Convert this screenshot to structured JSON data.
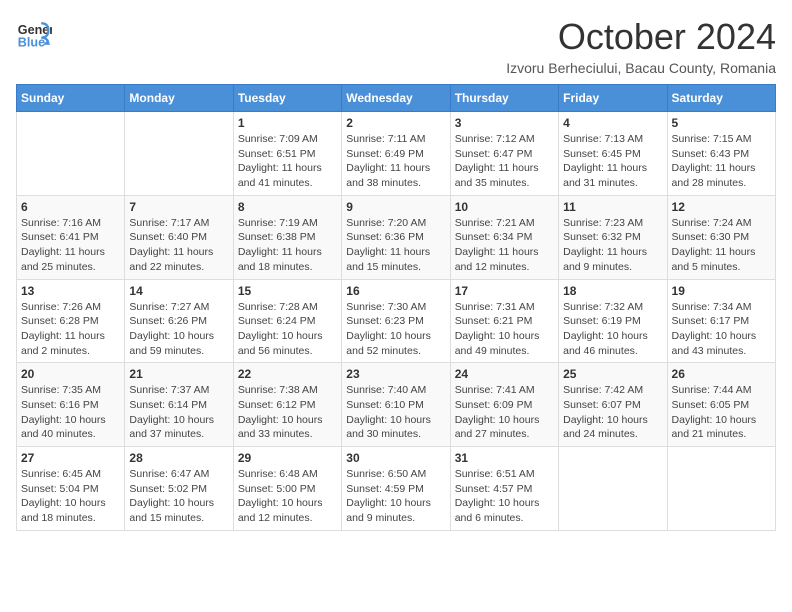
{
  "header": {
    "logo": {
      "general": "General",
      "blue": "Blue"
    },
    "title": "October 2024",
    "location": "Izvoru Berheciului, Bacau County, Romania"
  },
  "calendar": {
    "days_of_week": [
      "Sunday",
      "Monday",
      "Tuesday",
      "Wednesday",
      "Thursday",
      "Friday",
      "Saturday"
    ],
    "weeks": [
      [
        {
          "day": "",
          "info": ""
        },
        {
          "day": "",
          "info": ""
        },
        {
          "day": "1",
          "info": "Sunrise: 7:09 AM\nSunset: 6:51 PM\nDaylight: 11 hours and 41 minutes."
        },
        {
          "day": "2",
          "info": "Sunrise: 7:11 AM\nSunset: 6:49 PM\nDaylight: 11 hours and 38 minutes."
        },
        {
          "day": "3",
          "info": "Sunrise: 7:12 AM\nSunset: 6:47 PM\nDaylight: 11 hours and 35 minutes."
        },
        {
          "day": "4",
          "info": "Sunrise: 7:13 AM\nSunset: 6:45 PM\nDaylight: 11 hours and 31 minutes."
        },
        {
          "day": "5",
          "info": "Sunrise: 7:15 AM\nSunset: 6:43 PM\nDaylight: 11 hours and 28 minutes."
        }
      ],
      [
        {
          "day": "6",
          "info": "Sunrise: 7:16 AM\nSunset: 6:41 PM\nDaylight: 11 hours and 25 minutes."
        },
        {
          "day": "7",
          "info": "Sunrise: 7:17 AM\nSunset: 6:40 PM\nDaylight: 11 hours and 22 minutes."
        },
        {
          "day": "8",
          "info": "Sunrise: 7:19 AM\nSunset: 6:38 PM\nDaylight: 11 hours and 18 minutes."
        },
        {
          "day": "9",
          "info": "Sunrise: 7:20 AM\nSunset: 6:36 PM\nDaylight: 11 hours and 15 minutes."
        },
        {
          "day": "10",
          "info": "Sunrise: 7:21 AM\nSunset: 6:34 PM\nDaylight: 11 hours and 12 minutes."
        },
        {
          "day": "11",
          "info": "Sunrise: 7:23 AM\nSunset: 6:32 PM\nDaylight: 11 hours and 9 minutes."
        },
        {
          "day": "12",
          "info": "Sunrise: 7:24 AM\nSunset: 6:30 PM\nDaylight: 11 hours and 5 minutes."
        }
      ],
      [
        {
          "day": "13",
          "info": "Sunrise: 7:26 AM\nSunset: 6:28 PM\nDaylight: 11 hours and 2 minutes."
        },
        {
          "day": "14",
          "info": "Sunrise: 7:27 AM\nSunset: 6:26 PM\nDaylight: 10 hours and 59 minutes."
        },
        {
          "day": "15",
          "info": "Sunrise: 7:28 AM\nSunset: 6:24 PM\nDaylight: 10 hours and 56 minutes."
        },
        {
          "day": "16",
          "info": "Sunrise: 7:30 AM\nSunset: 6:23 PM\nDaylight: 10 hours and 52 minutes."
        },
        {
          "day": "17",
          "info": "Sunrise: 7:31 AM\nSunset: 6:21 PM\nDaylight: 10 hours and 49 minutes."
        },
        {
          "day": "18",
          "info": "Sunrise: 7:32 AM\nSunset: 6:19 PM\nDaylight: 10 hours and 46 minutes."
        },
        {
          "day": "19",
          "info": "Sunrise: 7:34 AM\nSunset: 6:17 PM\nDaylight: 10 hours and 43 minutes."
        }
      ],
      [
        {
          "day": "20",
          "info": "Sunrise: 7:35 AM\nSunset: 6:16 PM\nDaylight: 10 hours and 40 minutes."
        },
        {
          "day": "21",
          "info": "Sunrise: 7:37 AM\nSunset: 6:14 PM\nDaylight: 10 hours and 37 minutes."
        },
        {
          "day": "22",
          "info": "Sunrise: 7:38 AM\nSunset: 6:12 PM\nDaylight: 10 hours and 33 minutes."
        },
        {
          "day": "23",
          "info": "Sunrise: 7:40 AM\nSunset: 6:10 PM\nDaylight: 10 hours and 30 minutes."
        },
        {
          "day": "24",
          "info": "Sunrise: 7:41 AM\nSunset: 6:09 PM\nDaylight: 10 hours and 27 minutes."
        },
        {
          "day": "25",
          "info": "Sunrise: 7:42 AM\nSunset: 6:07 PM\nDaylight: 10 hours and 24 minutes."
        },
        {
          "day": "26",
          "info": "Sunrise: 7:44 AM\nSunset: 6:05 PM\nDaylight: 10 hours and 21 minutes."
        }
      ],
      [
        {
          "day": "27",
          "info": "Sunrise: 6:45 AM\nSunset: 5:04 PM\nDaylight: 10 hours and 18 minutes."
        },
        {
          "day": "28",
          "info": "Sunrise: 6:47 AM\nSunset: 5:02 PM\nDaylight: 10 hours and 15 minutes."
        },
        {
          "day": "29",
          "info": "Sunrise: 6:48 AM\nSunset: 5:00 PM\nDaylight: 10 hours and 12 minutes."
        },
        {
          "day": "30",
          "info": "Sunrise: 6:50 AM\nSunset: 4:59 PM\nDaylight: 10 hours and 9 minutes."
        },
        {
          "day": "31",
          "info": "Sunrise: 6:51 AM\nSunset: 4:57 PM\nDaylight: 10 hours and 6 minutes."
        },
        {
          "day": "",
          "info": ""
        },
        {
          "day": "",
          "info": ""
        }
      ]
    ]
  }
}
